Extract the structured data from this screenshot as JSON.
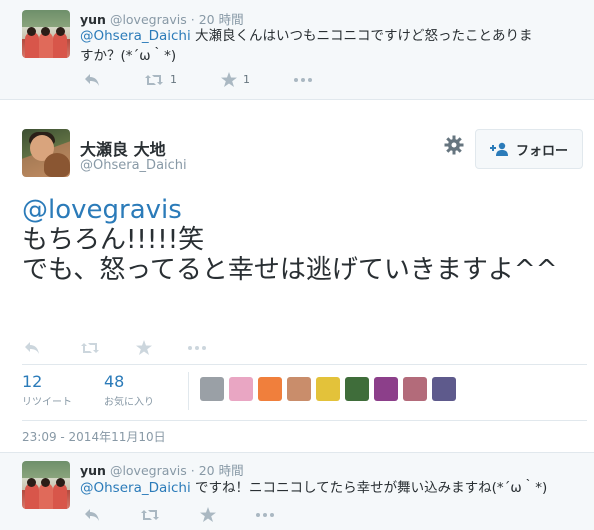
{
  "reply_top": {
    "name": "yun",
    "handle": "@lovegravis",
    "separator": "·",
    "time": "20 時間",
    "mention": "@Ohsera_Daichi",
    "text_line1": " 大瀬良くんはいつもニコニコですけど怒ったことありま",
    "text_line2": "すか？(*´ω｀*)",
    "retweet_count": "1",
    "like_count": "1",
    "icons": [
      "reply-icon",
      "retweet-icon",
      "favorite-icon",
      "more-icon"
    ]
  },
  "main_tweet": {
    "name": "大瀬良 大地",
    "handle": "@Ohsera_Daichi",
    "follow_label": "フォロー",
    "mention": "@lovegravis",
    "line1": "もちろん!!!!!笑",
    "line2": "でも、怒ってると幸せは逃げていきますよ^^",
    "icons": [
      "reply-icon",
      "retweet-icon",
      "favorite-icon",
      "more-icon",
      "gear-icon",
      "follow-person-icon"
    ]
  },
  "stats": {
    "retweets": {
      "value": "12",
      "label": "リツイート"
    },
    "favorites": {
      "value": "48",
      "label": "お気に入り"
    }
  },
  "favorited_by_avatars": [
    "#9aa0a6",
    "#e9a6c3",
    "#f07f3c",
    "#c98d6b",
    "#e3c23a",
    "#3f6d3a",
    "#8c3f8a",
    "#b36b7a",
    "#5e5a8c"
  ],
  "timestamp": "23:09 - 2014年11月10日",
  "reply_bottom": {
    "name": "yun",
    "handle": "@lovegravis",
    "separator": "·",
    "time": "20 時間",
    "mention": "@Ohsera_Daichi",
    "text": " ですね！ニコニコしてたら幸せが舞い込みますね(*´ω｀*)"
  },
  "colors": {
    "link": "#2b7bb9",
    "muted": "#8899a6",
    "icon": "#aab8c2",
    "reply_bg": "#f5f8fa",
    "border": "#e1e8ed"
  }
}
